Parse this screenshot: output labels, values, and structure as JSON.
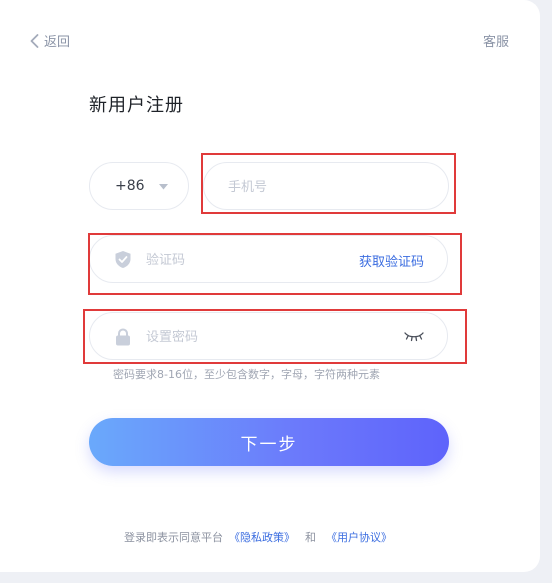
{
  "header": {
    "back_label": "返回",
    "service_label": "客服"
  },
  "page_title": "新用户注册",
  "country_code": {
    "value": "+86"
  },
  "phone": {
    "placeholder": "手机号"
  },
  "verify_code": {
    "placeholder": "验证码",
    "get_code_label": "获取验证码"
  },
  "password": {
    "placeholder": "设置密码",
    "hint": "密码要求8-16位，至少包含数字，字母，字符两种元素"
  },
  "next_button_label": "下一步",
  "agreement": {
    "prefix": "登录即表示同意平台",
    "privacy_link": "《隐私政策》",
    "and": "和",
    "user_agreement_link": "《用户协议》"
  },
  "colors": {
    "accent": "#3b6de0",
    "highlight_box": "#e03a3a",
    "button_gradient_start": "#6aa9fb",
    "button_gradient_end": "#5e63fb"
  },
  "icons": [
    "chevron-left-icon",
    "caret-down-icon",
    "shield-check-icon",
    "lock-icon",
    "eye-closed-icon"
  ]
}
